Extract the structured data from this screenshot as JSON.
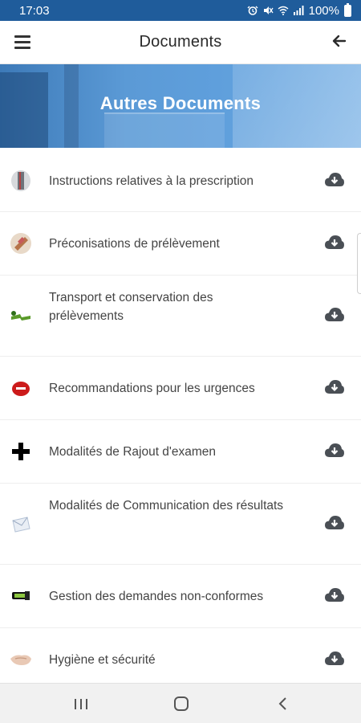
{
  "status_bar": {
    "time": "17:03",
    "battery": "100%",
    "icons": [
      "alarm-icon",
      "mute-icon",
      "wifi-icon",
      "signal-icon",
      "battery-icon"
    ]
  },
  "app_bar": {
    "title": "Documents",
    "menu_icon": "hamburger-menu-icon",
    "back_icon": "arrow-back-icon"
  },
  "banner": {
    "title": "Autres Documents"
  },
  "documents": [
    {
      "label": "Instructions relatives à la prescription",
      "icon": "instruction-icon"
    },
    {
      "label": "Préconisations de prélèvement",
      "icon": "sampling-icon"
    },
    {
      "label": "Transport et conservation des prélèvements",
      "icon": "transport-icon"
    },
    {
      "label": "Recommandations pour les urgences",
      "icon": "emergency-icon"
    },
    {
      "label": "Modalités de Rajout d'examen",
      "icon": "plus-icon"
    },
    {
      "label": "Modalités de Communication des résultats",
      "icon": "communication-icon"
    },
    {
      "label": "Gestion des demandes non-conformes",
      "icon": "nonconform-icon"
    },
    {
      "label": "Hygiène et sécurité",
      "icon": "hygiene-icon"
    }
  ],
  "colors": {
    "status_bar": "#1f5c9b",
    "banner": "#5b9ad6",
    "text": "#444444",
    "download_icon": "#4a4f55"
  },
  "nav_bar": {
    "icons": [
      "recent-apps-icon",
      "home-icon",
      "back-nav-icon"
    ]
  }
}
